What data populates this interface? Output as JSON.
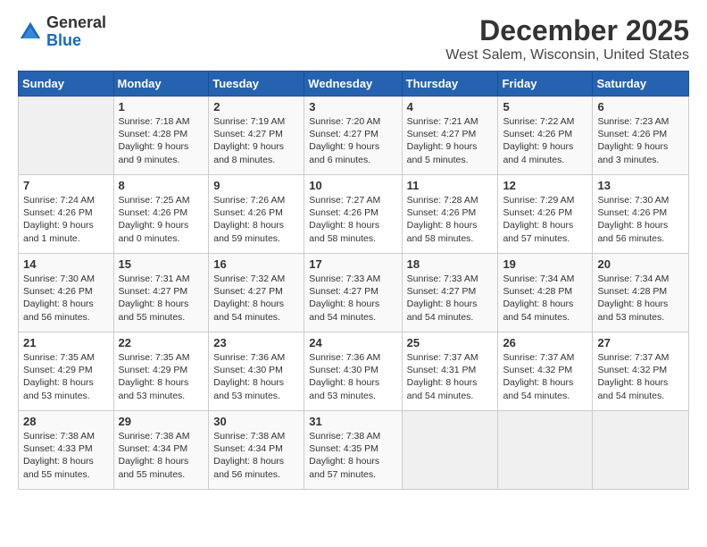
{
  "logo": {
    "line1": "General",
    "line2": "Blue"
  },
  "title": "December 2025",
  "location": "West Salem, Wisconsin, United States",
  "days_header": [
    "Sunday",
    "Monday",
    "Tuesday",
    "Wednesday",
    "Thursday",
    "Friday",
    "Saturday"
  ],
  "weeks": [
    [
      {
        "day": "",
        "info": ""
      },
      {
        "day": "1",
        "info": "Sunrise: 7:18 AM\nSunset: 4:28 PM\nDaylight: 9 hours\nand 9 minutes."
      },
      {
        "day": "2",
        "info": "Sunrise: 7:19 AM\nSunset: 4:27 PM\nDaylight: 9 hours\nand 8 minutes."
      },
      {
        "day": "3",
        "info": "Sunrise: 7:20 AM\nSunset: 4:27 PM\nDaylight: 9 hours\nand 6 minutes."
      },
      {
        "day": "4",
        "info": "Sunrise: 7:21 AM\nSunset: 4:27 PM\nDaylight: 9 hours\nand 5 minutes."
      },
      {
        "day": "5",
        "info": "Sunrise: 7:22 AM\nSunset: 4:26 PM\nDaylight: 9 hours\nand 4 minutes."
      },
      {
        "day": "6",
        "info": "Sunrise: 7:23 AM\nSunset: 4:26 PM\nDaylight: 9 hours\nand 3 minutes."
      }
    ],
    [
      {
        "day": "7",
        "info": "Sunrise: 7:24 AM\nSunset: 4:26 PM\nDaylight: 9 hours\nand 1 minute."
      },
      {
        "day": "8",
        "info": "Sunrise: 7:25 AM\nSunset: 4:26 PM\nDaylight: 9 hours\nand 0 minutes."
      },
      {
        "day": "9",
        "info": "Sunrise: 7:26 AM\nSunset: 4:26 PM\nDaylight: 8 hours\nand 59 minutes."
      },
      {
        "day": "10",
        "info": "Sunrise: 7:27 AM\nSunset: 4:26 PM\nDaylight: 8 hours\nand 58 minutes."
      },
      {
        "day": "11",
        "info": "Sunrise: 7:28 AM\nSunset: 4:26 PM\nDaylight: 8 hours\nand 58 minutes."
      },
      {
        "day": "12",
        "info": "Sunrise: 7:29 AM\nSunset: 4:26 PM\nDaylight: 8 hours\nand 57 minutes."
      },
      {
        "day": "13",
        "info": "Sunrise: 7:30 AM\nSunset: 4:26 PM\nDaylight: 8 hours\nand 56 minutes."
      }
    ],
    [
      {
        "day": "14",
        "info": "Sunrise: 7:30 AM\nSunset: 4:26 PM\nDaylight: 8 hours\nand 56 minutes."
      },
      {
        "day": "15",
        "info": "Sunrise: 7:31 AM\nSunset: 4:27 PM\nDaylight: 8 hours\nand 55 minutes."
      },
      {
        "day": "16",
        "info": "Sunrise: 7:32 AM\nSunset: 4:27 PM\nDaylight: 8 hours\nand 54 minutes."
      },
      {
        "day": "17",
        "info": "Sunrise: 7:33 AM\nSunset: 4:27 PM\nDaylight: 8 hours\nand 54 minutes."
      },
      {
        "day": "18",
        "info": "Sunrise: 7:33 AM\nSunset: 4:27 PM\nDaylight: 8 hours\nand 54 minutes."
      },
      {
        "day": "19",
        "info": "Sunrise: 7:34 AM\nSunset: 4:28 PM\nDaylight: 8 hours\nand 54 minutes."
      },
      {
        "day": "20",
        "info": "Sunrise: 7:34 AM\nSunset: 4:28 PM\nDaylight: 8 hours\nand 53 minutes."
      }
    ],
    [
      {
        "day": "21",
        "info": "Sunrise: 7:35 AM\nSunset: 4:29 PM\nDaylight: 8 hours\nand 53 minutes."
      },
      {
        "day": "22",
        "info": "Sunrise: 7:35 AM\nSunset: 4:29 PM\nDaylight: 8 hours\nand 53 minutes."
      },
      {
        "day": "23",
        "info": "Sunrise: 7:36 AM\nSunset: 4:30 PM\nDaylight: 8 hours\nand 53 minutes."
      },
      {
        "day": "24",
        "info": "Sunrise: 7:36 AM\nSunset: 4:30 PM\nDaylight: 8 hours\nand 53 minutes."
      },
      {
        "day": "25",
        "info": "Sunrise: 7:37 AM\nSunset: 4:31 PM\nDaylight: 8 hours\nand 54 minutes."
      },
      {
        "day": "26",
        "info": "Sunrise: 7:37 AM\nSunset: 4:32 PM\nDaylight: 8 hours\nand 54 minutes."
      },
      {
        "day": "27",
        "info": "Sunrise: 7:37 AM\nSunset: 4:32 PM\nDaylight: 8 hours\nand 54 minutes."
      }
    ],
    [
      {
        "day": "28",
        "info": "Sunrise: 7:38 AM\nSunset: 4:33 PM\nDaylight: 8 hours\nand 55 minutes."
      },
      {
        "day": "29",
        "info": "Sunrise: 7:38 AM\nSunset: 4:34 PM\nDaylight: 8 hours\nand 55 minutes."
      },
      {
        "day": "30",
        "info": "Sunrise: 7:38 AM\nSunset: 4:34 PM\nDaylight: 8 hours\nand 56 minutes."
      },
      {
        "day": "31",
        "info": "Sunrise: 7:38 AM\nSunset: 4:35 PM\nDaylight: 8 hours\nand 57 minutes."
      },
      {
        "day": "",
        "info": ""
      },
      {
        "day": "",
        "info": ""
      },
      {
        "day": "",
        "info": ""
      }
    ]
  ]
}
